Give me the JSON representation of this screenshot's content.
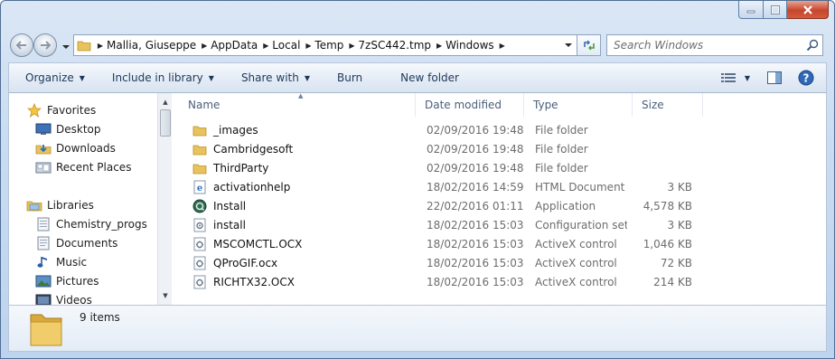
{
  "window": {
    "controls": [
      "minimize-icon",
      "maximize-icon",
      "close-icon"
    ]
  },
  "address_bar": {
    "breadcrumbs": [
      "Mallia, Giuseppe",
      "AppData",
      "Local",
      "Temp",
      "7zSC442.tmp",
      "Windows"
    ]
  },
  "search": {
    "placeholder": "Search Windows"
  },
  "toolbar": {
    "organize": "Organize",
    "include_in_library": "Include in library",
    "share_with": "Share with",
    "burn": "Burn",
    "new_folder": "New folder"
  },
  "navigation": {
    "favorites": {
      "label": "Favorites",
      "icon": "star-icon",
      "items": [
        {
          "label": "Desktop",
          "icon": "desktop-icon"
        },
        {
          "label": "Downloads",
          "icon": "downloads-icon"
        },
        {
          "label": "Recent Places",
          "icon": "recent-places-icon"
        }
      ]
    },
    "libraries": {
      "label": "Libraries",
      "icon": "libraries-icon",
      "items": [
        {
          "label": "Chemistry_progs",
          "icon": "library-icon"
        },
        {
          "label": "Documents",
          "icon": "documents-icon"
        },
        {
          "label": "Music",
          "icon": "music-icon"
        },
        {
          "label": "Pictures",
          "icon": "pictures-icon"
        },
        {
          "label": "Videos",
          "icon": "videos-icon"
        }
      ]
    }
  },
  "columns": {
    "name": "Name",
    "date_modified": "Date modified",
    "type": "Type",
    "size": "Size"
  },
  "files": [
    {
      "name": "_images",
      "date": "02/09/2016 19:48",
      "type": "File folder",
      "size": "",
      "icon": "folder"
    },
    {
      "name": "Cambridgesoft",
      "date": "02/09/2016 19:48",
      "type": "File folder",
      "size": "",
      "icon": "folder"
    },
    {
      "name": "ThirdParty",
      "date": "02/09/2016 19:48",
      "type": "File folder",
      "size": "",
      "icon": "folder"
    },
    {
      "name": "activationhelp",
      "date": "18/02/2016 14:59",
      "type": "HTML Document",
      "size": "3 KB",
      "icon": "html"
    },
    {
      "name": "Install",
      "date": "22/02/2016 01:11",
      "type": "Application",
      "size": "4,578 KB",
      "icon": "app"
    },
    {
      "name": "install",
      "date": "18/02/2016 15:03",
      "type": "Configuration sett...",
      "size": "3 KB",
      "icon": "config"
    },
    {
      "name": "MSCOMCTL.OCX",
      "date": "18/02/2016 15:03",
      "type": "ActiveX control",
      "size": "1,046 KB",
      "icon": "ocx"
    },
    {
      "name": "QProGIF.ocx",
      "date": "18/02/2016 15:03",
      "type": "ActiveX control",
      "size": "72 KB",
      "icon": "ocx"
    },
    {
      "name": "RICHTX32.OCX",
      "date": "18/02/2016 15:03",
      "type": "ActiveX control",
      "size": "214 KB",
      "icon": "ocx"
    }
  ],
  "details": {
    "item_count": "9 items"
  },
  "colors": {
    "folder": "#e8c25a",
    "accent": "#1e395b",
    "muted_text": "#6d6d6d"
  }
}
